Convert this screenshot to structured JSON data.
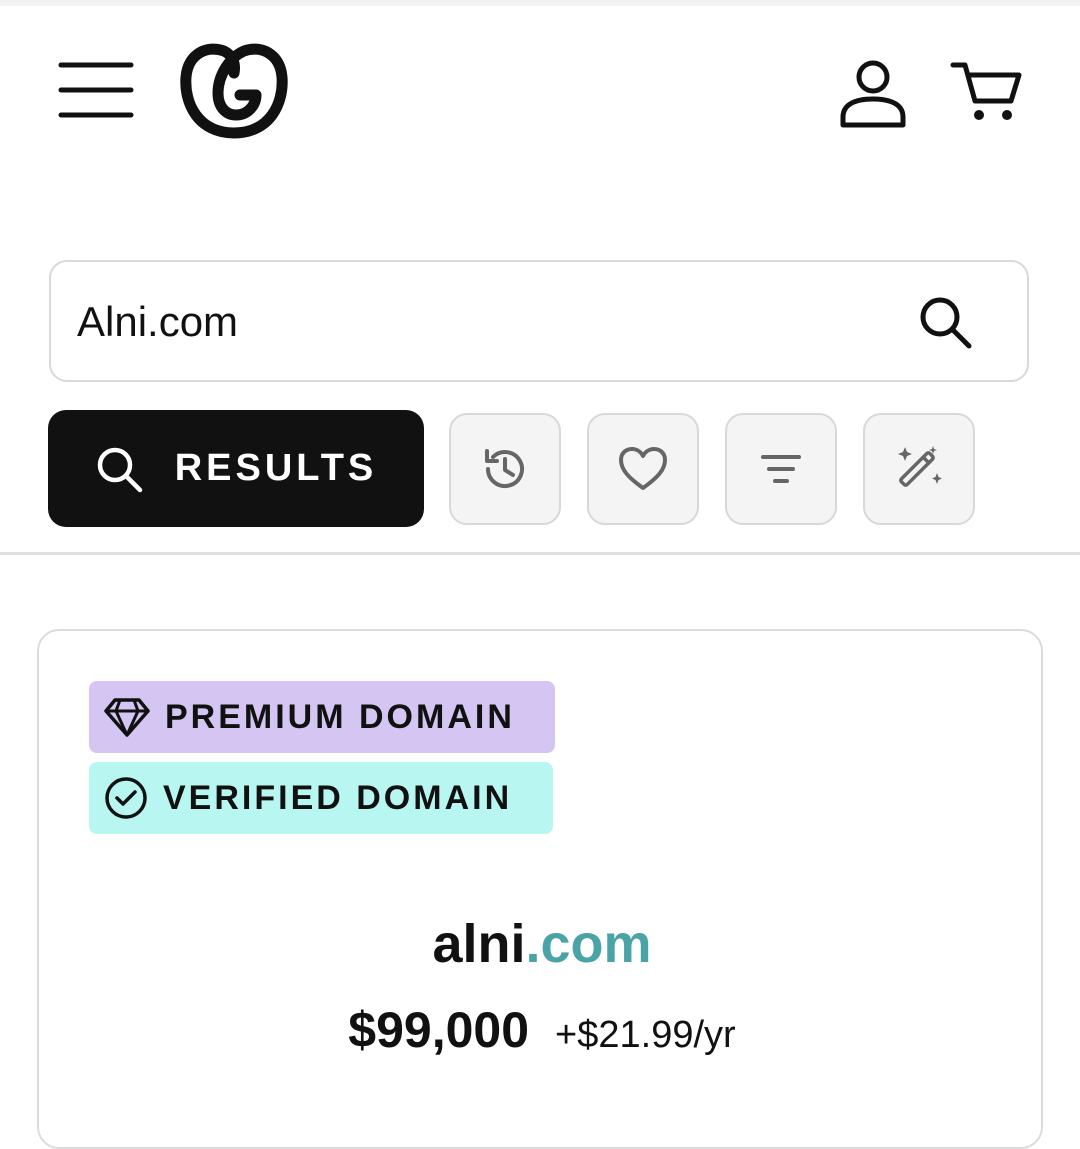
{
  "search": {
    "value": "Alni.com"
  },
  "toolbar": {
    "results_label": "RESULTS"
  },
  "result_card": {
    "badges": [
      {
        "label": "PREMIUM DOMAIN",
        "color": "#d4c5f2"
      },
      {
        "label": "VERIFIED DOMAIN",
        "color": "#b8f7f1"
      }
    ],
    "domain_sld": "alni",
    "domain_tld": ".com",
    "price": "$99,000",
    "renewal": "+$21.99/yr"
  },
  "icons": {
    "header": [
      "menu-icon",
      "logo-icon",
      "account-icon",
      "cart-icon"
    ],
    "search": "search-icon",
    "tools": [
      "history-icon",
      "heart-icon",
      "filter-icon",
      "magic-wand-icon"
    ],
    "badges": [
      "diamond-icon",
      "check-circle-icon"
    ]
  },
  "colors": {
    "tld": "#4aa3a6",
    "primary_button": "#111111"
  }
}
